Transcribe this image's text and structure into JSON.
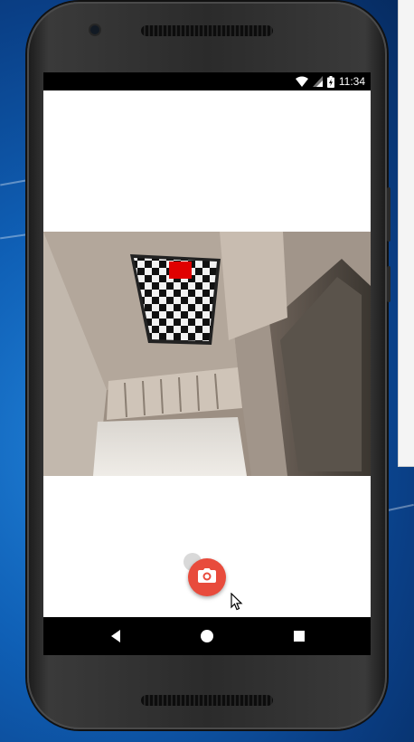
{
  "status_bar": {
    "time": "11:34",
    "icons": [
      "wifi-icon",
      "cell-signal-icon",
      "battery-charging-icon"
    ]
  },
  "camera": {
    "capture_button_icon": "camera-icon",
    "marker_color": "#e00000",
    "accent_color": "#e84b3c"
  },
  "nav_bar": {
    "buttons": [
      "back-icon",
      "home-icon",
      "recents-icon"
    ]
  }
}
